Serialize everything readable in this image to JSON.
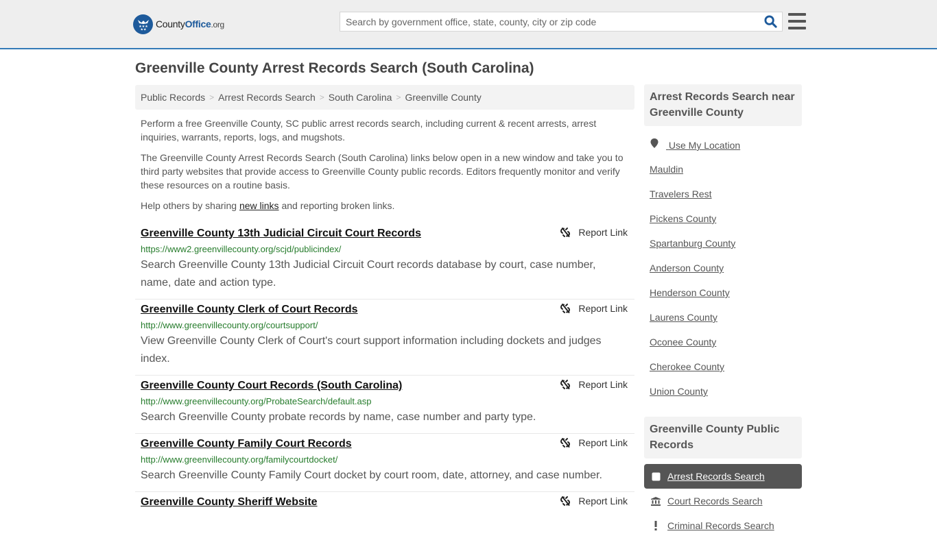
{
  "header": {
    "logo": {
      "county": "County",
      "office": "Office",
      "org": ".org"
    },
    "search": {
      "placeholder": "Search by government office, state, county, city or zip code",
      "value": ""
    },
    "colors": {
      "brand": "#1d5a9b",
      "accent_border": "#337ab7",
      "url_green": "#267c2c"
    }
  },
  "page": {
    "title": "Greenville County Arrest Records Search (South Carolina)",
    "breadcrumb": [
      "Public Records",
      "Arrest Records Search",
      "South Carolina",
      "Greenville County"
    ],
    "intro": {
      "p1": "Perform a free Greenville County, SC public arrest records search, including current & recent arrests, arrest inquiries, warrants, reports, logs, and mugshots.",
      "p2": "The Greenville County Arrest Records Search (South Carolina) links below open in a new window and take you to third party websites that provide access to Greenville County public records. Editors frequently monitor and verify these resources on a routine basis.",
      "p3_before": "Help others by sharing ",
      "p3_link": "new links",
      "p3_after": " and reporting broken links."
    },
    "report_label": "Report Link",
    "results": [
      {
        "title": "Greenville County 13th Judicial Circuit Court Records",
        "url": "https://www2.greenvillecounty.org/scjd/publicindex/",
        "description": "Search Greenville County 13th Judicial Circuit Court records database by court, case number, name, date and action type."
      },
      {
        "title": "Greenville County Clerk of Court Records",
        "url": "http://www.greenvillecounty.org/courtsupport/",
        "description": "View Greenville County Clerk of Court's court support information including dockets and judges index."
      },
      {
        "title": "Greenville County Court Records (South Carolina)",
        "url": "http://www.greenvillecounty.org/ProbateSearch/default.asp",
        "description": "Search Greenville County probate records by name, case number and party type."
      },
      {
        "title": "Greenville County Family Court Records",
        "url": "http://www.greenvillecounty.org/familycourtdocket/",
        "description": "Search Greenville County Family Court docket by court room, date, attorney, and case number."
      },
      {
        "title": "Greenville County Sheriff Website",
        "url": "",
        "description": ""
      }
    ]
  },
  "sidebar": {
    "nearby": {
      "heading": "Arrest Records Search near Greenville County",
      "use_location": "Use My Location",
      "places": [
        "Mauldin",
        "Travelers Rest",
        "Pickens County",
        "Spartanburg County",
        "Anderson County",
        "Henderson County",
        "Laurens County",
        "Oconee County",
        "Cherokee County",
        "Union County"
      ]
    },
    "public_records": {
      "heading": "Greenville County Public Records",
      "items": [
        {
          "label": "Arrest Records Search",
          "icon": "square-icon",
          "active": true
        },
        {
          "label": "Court Records Search",
          "icon": "courthouse-icon",
          "active": false
        },
        {
          "label": "Criminal Records Search",
          "icon": "exclamation-icon",
          "active": false
        }
      ]
    }
  }
}
